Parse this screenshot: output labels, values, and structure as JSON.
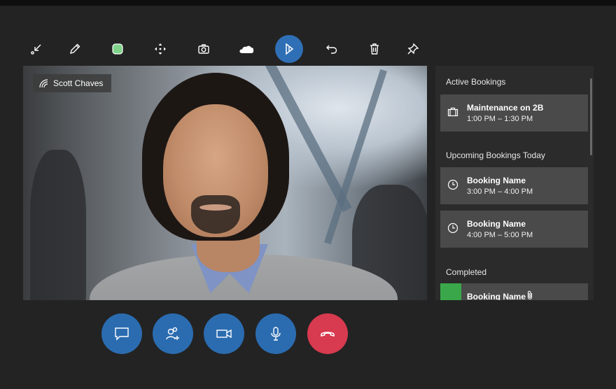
{
  "toolbar": {
    "icons": [
      "minimize-icon",
      "pen-icon",
      "color-swatch-icon",
      "move-icon",
      "camera-icon",
      "onedrive-icon",
      "select-icon",
      "undo-icon",
      "delete-icon",
      "pin-icon"
    ],
    "active": "select-icon",
    "swatch_color": "#7fd38a",
    "accent_color": "#2f6fb5"
  },
  "video": {
    "participant_name": "Scott Chaves"
  },
  "panel": {
    "active_title": "Active Bookings",
    "active": [
      {
        "title": "Maintenance on 2B",
        "time": "1:00 PM – 1:30 PM",
        "icon": "briefcase-icon"
      }
    ],
    "upcoming_title": "Upcoming Bookings Today",
    "upcoming": [
      {
        "title": "Booking Name",
        "time": "3:00 PM – 4:00 PM",
        "icon": "clock-icon"
      },
      {
        "title": "Booking Name",
        "time": "4:00 PM – 5:00 PM",
        "icon": "clock-icon"
      }
    ],
    "completed_title": "Completed",
    "completed": [
      {
        "title": "Booking Name",
        "icon": "paperclip-icon",
        "color": "#3aa84a"
      }
    ]
  },
  "controls": {
    "buttons": [
      "chat-icon",
      "add-people-icon",
      "video-icon",
      "microphone-icon",
      "end-call-icon"
    ],
    "colors": {
      "primary": "#2b6cb0",
      "end": "#d83a4f"
    }
  }
}
